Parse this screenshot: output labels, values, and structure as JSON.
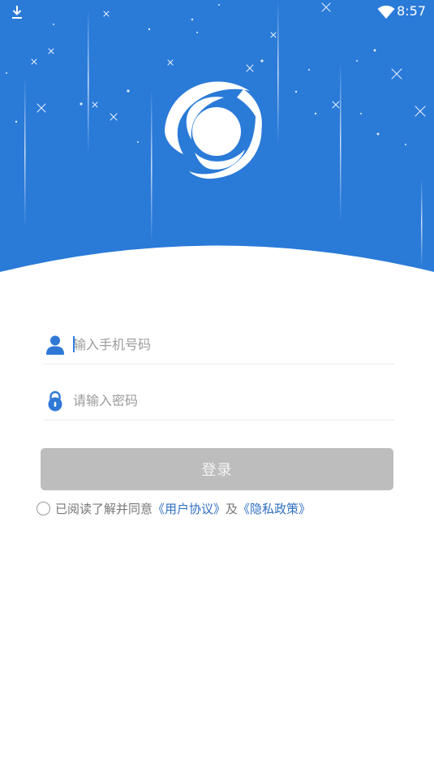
{
  "status_bar": {
    "time": "8:57",
    "download_icon": "download-icon",
    "wifi_icon": "wifi-icon"
  },
  "header": {
    "logo_icon": "orbit-logo-icon",
    "background_color": "#2a7ad8"
  },
  "form": {
    "phone": {
      "icon": "user-icon",
      "placeholder": "输入手机号码",
      "value": ""
    },
    "password": {
      "icon": "lock-icon",
      "placeholder": "请输入密码",
      "value": ""
    },
    "login_label": "登录"
  },
  "agreement": {
    "prefix": "已阅读了解并同意",
    "user_agreement": "《用户协议》",
    "conjunction": "及",
    "privacy_policy": "《隐私政策》",
    "checked": false
  },
  "colors": {
    "primary": "#2a7ad8",
    "button_disabled": "#bdbdbd",
    "link": "#2f6fc0",
    "icon": "#2f78d6"
  }
}
